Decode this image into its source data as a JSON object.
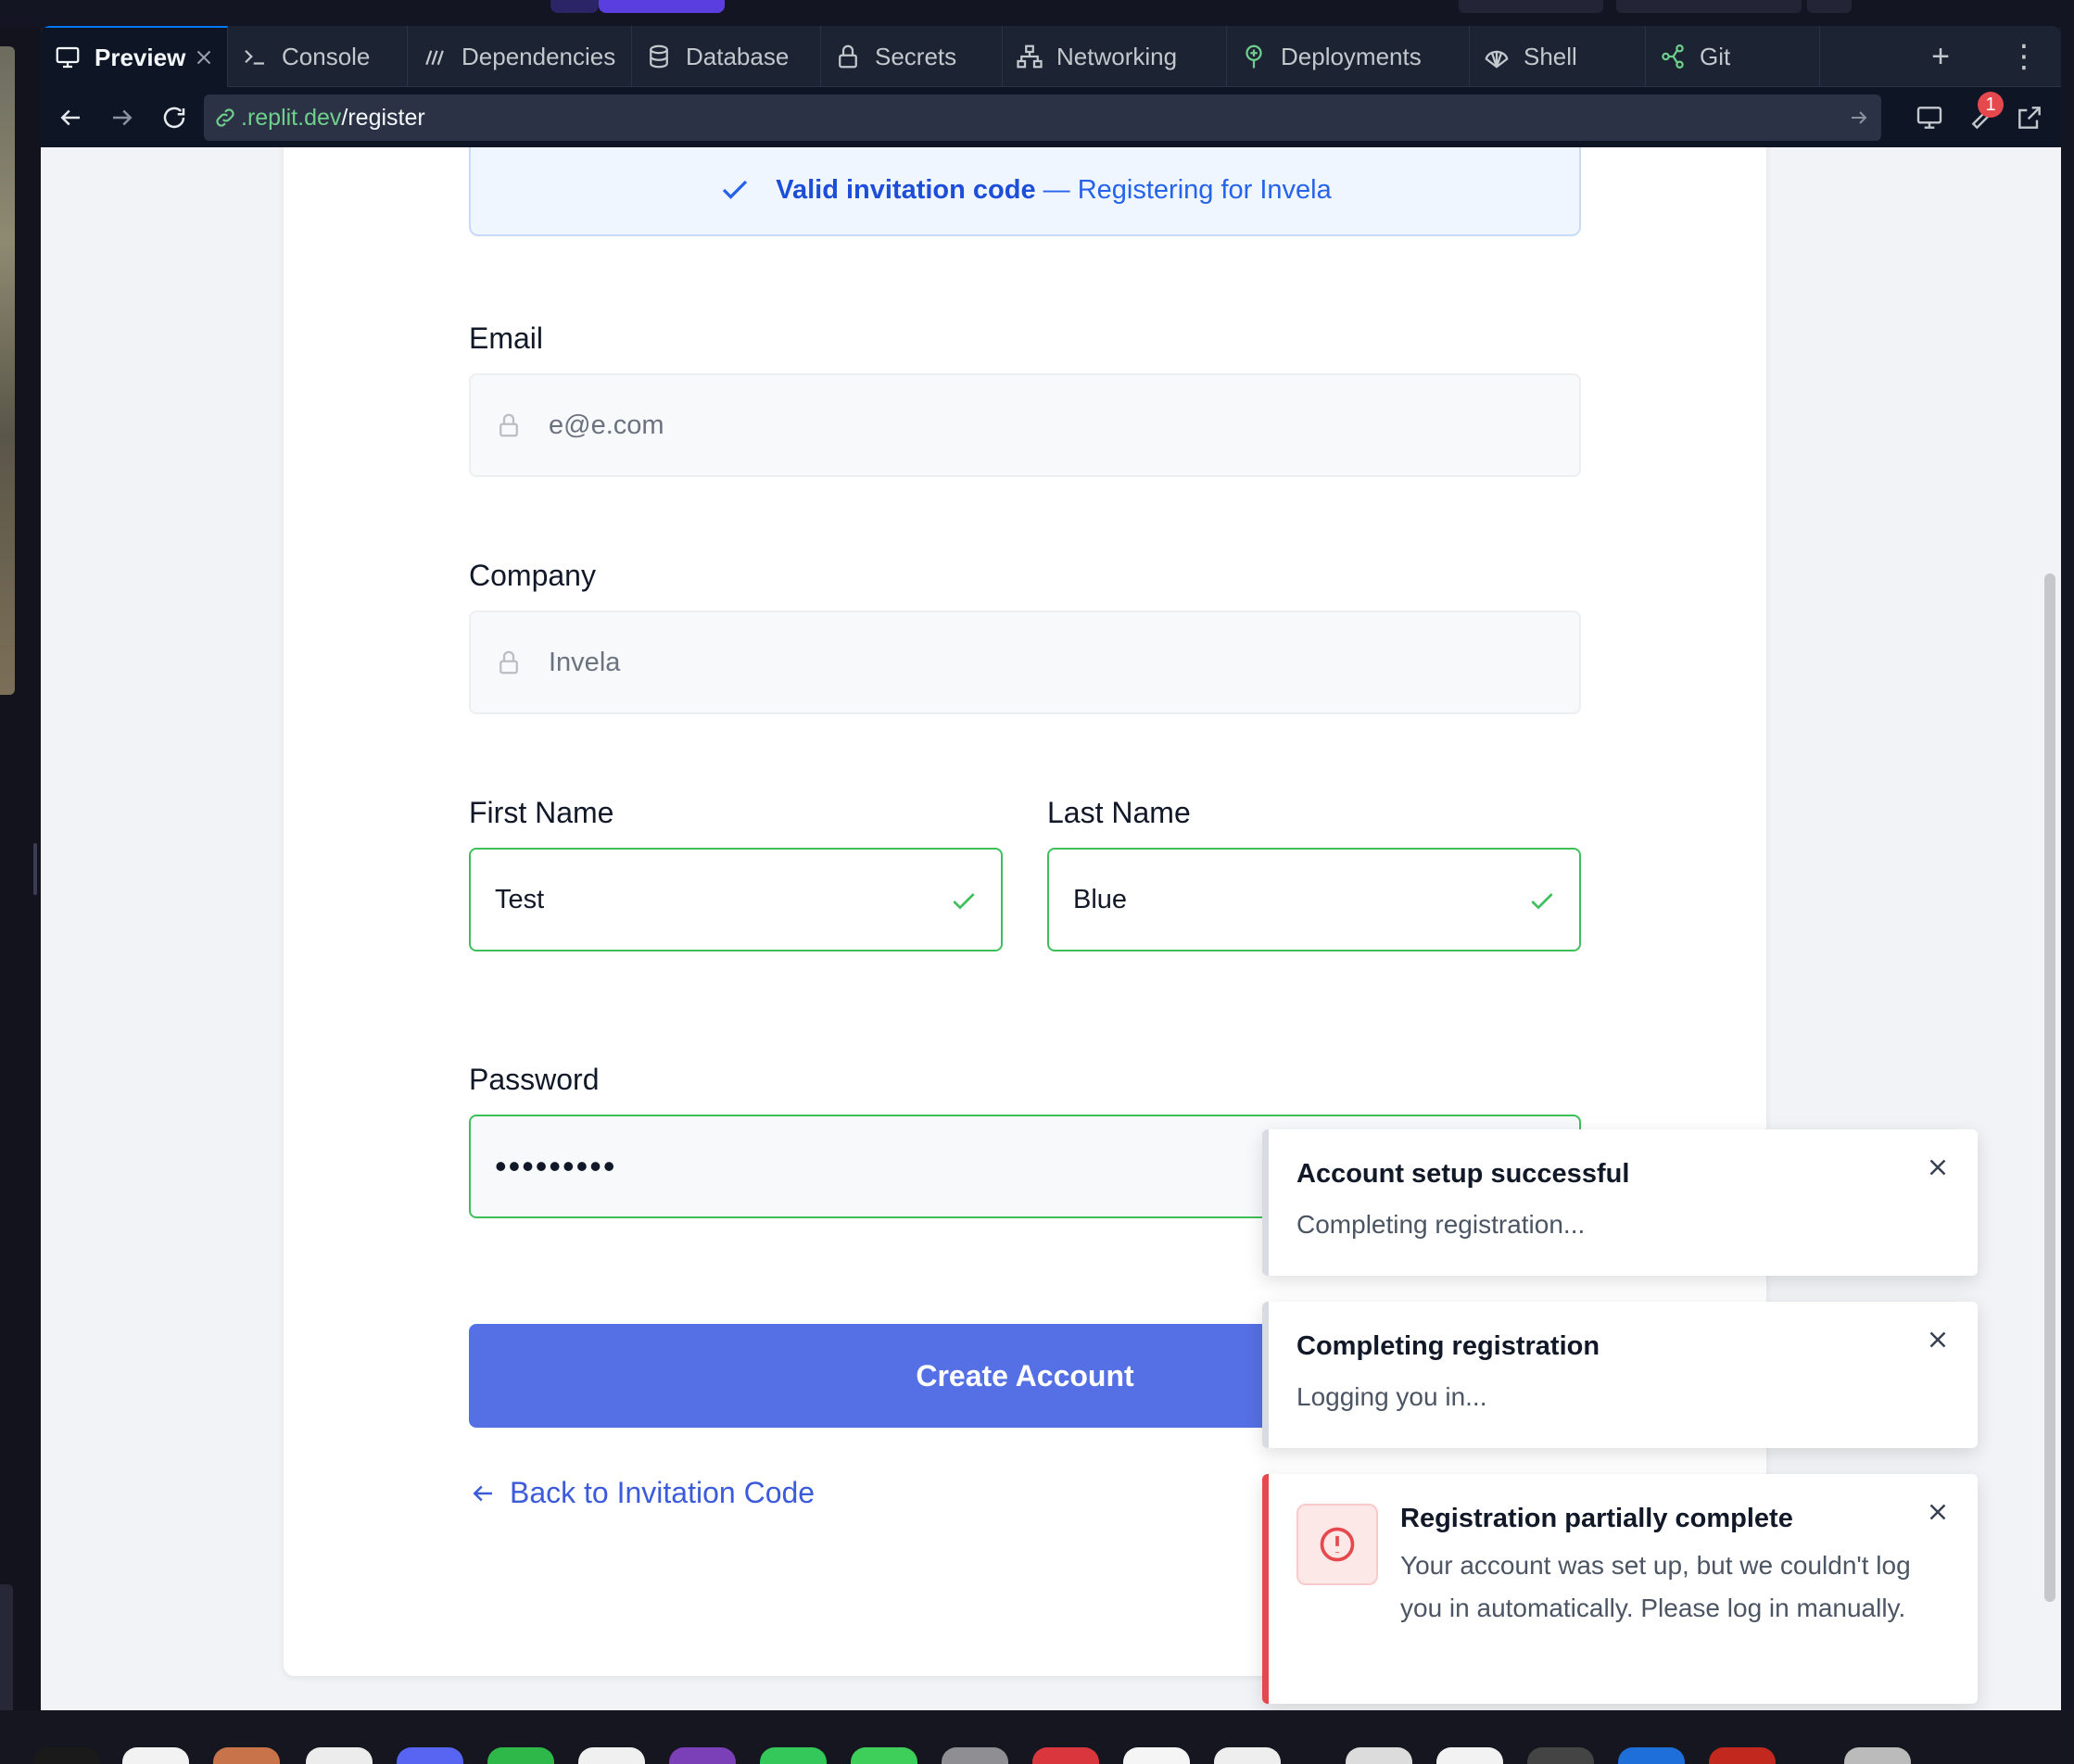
{
  "tabs": [
    {
      "label": "Preview",
      "icon": "monitor-icon",
      "active": true
    },
    {
      "label": "Console",
      "icon": "terminal-icon"
    },
    {
      "label": "Dependencies",
      "icon": "dependencies-icon"
    },
    {
      "label": "Database",
      "icon": "database-icon"
    },
    {
      "label": "Secrets",
      "icon": "lock-icon"
    },
    {
      "label": "Networking",
      "icon": "network-icon"
    },
    {
      "label": "Deployments",
      "icon": "deployments-icon"
    },
    {
      "label": "Shell",
      "icon": "shell-icon"
    },
    {
      "label": "Git",
      "icon": "git-icon"
    }
  ],
  "tab_actions": {
    "add": "+",
    "more": "⋮"
  },
  "url": {
    "host": ".replit.dev",
    "path": "/register"
  },
  "notifications": {
    "count": "1"
  },
  "banner": {
    "strong": "Valid invitation code",
    "rest": " — Registering for Invela"
  },
  "form": {
    "email": {
      "label": "Email",
      "value": "e@e.com"
    },
    "company": {
      "label": "Company",
      "value": "Invela"
    },
    "first_name": {
      "label": "First Name",
      "value": "Test"
    },
    "last_name": {
      "label": "Last Name",
      "value": "Blue"
    },
    "password": {
      "label": "Password",
      "value": "•••••••••"
    },
    "submit": "Create Account",
    "back": "Back to Invitation Code"
  },
  "toasts": [
    {
      "title": "Account setup successful",
      "desc": "Completing registration..."
    },
    {
      "title": "Completing registration",
      "desc": "Logging you in..."
    },
    {
      "title": "Registration partially complete",
      "desc": "Your account was set up, but we couldn't log you in automatically. Please log in manually.",
      "variant": "error"
    }
  ],
  "colors": {
    "accent": "#5570e4",
    "valid": "#3fbf5a",
    "error": "#e5484d",
    "link": "#3b5bdb"
  }
}
